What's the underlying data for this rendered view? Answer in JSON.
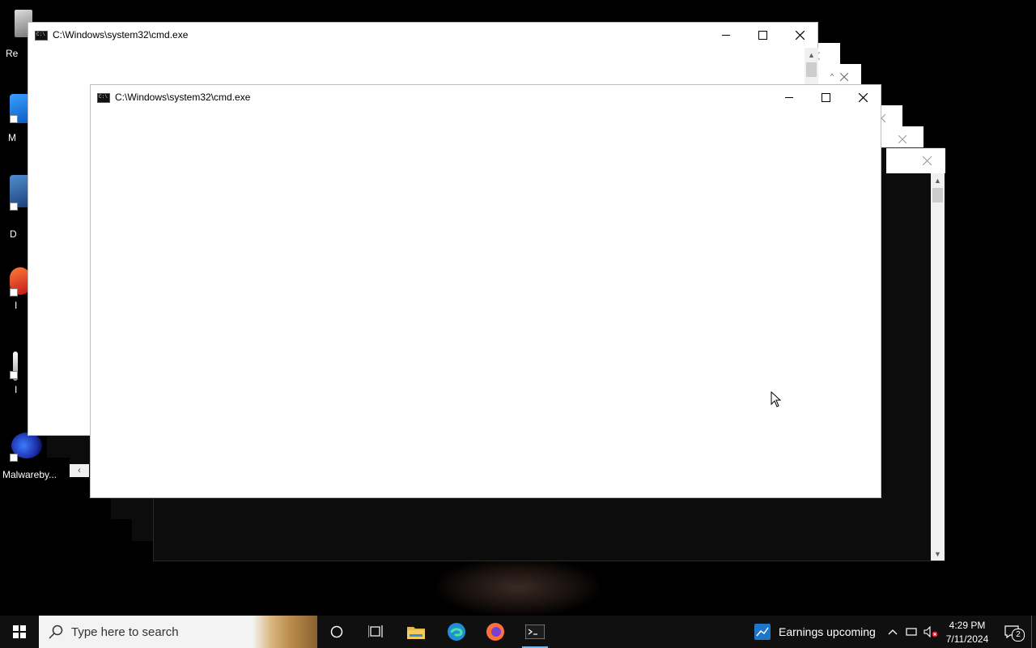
{
  "desktop": {
    "icons": [
      {
        "label": "Re"
      },
      {
        "label": "M"
      },
      {
        "label": "D"
      },
      {
        "label": "I"
      },
      {
        "label": "I"
      },
      {
        "label": "Malwareby..."
      }
    ]
  },
  "windows": {
    "back": {
      "title": "C:\\Windows\\system32\\cmd.exe"
    },
    "front": {
      "title": "C:\\Windows\\system32\\cmd.exe"
    }
  },
  "taskbar": {
    "search_placeholder": "Type here to search",
    "news": "Earnings upcoming",
    "time": "4:29 PM",
    "date": "7/11/2024",
    "notification_count": "2",
    "apps": [
      "start-icon",
      "cortana-icon",
      "task-view-icon",
      "file-explorer-icon",
      "edge-icon",
      "firefox-icon",
      "terminal-icon"
    ]
  },
  "colors": {
    "accent": "#76b9ed",
    "taskbar_bg": "#101010",
    "window_bg": "#ffffff",
    "console_bg": "#0c0c0c"
  }
}
